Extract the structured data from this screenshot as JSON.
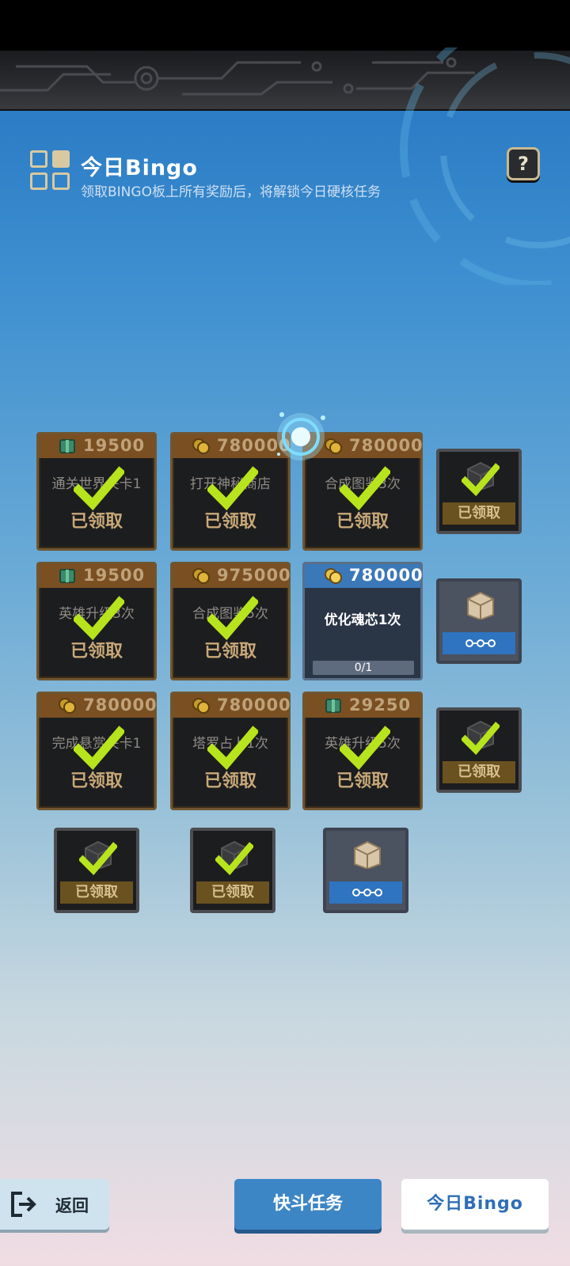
{
  "header": {
    "title": "今日Bingo",
    "subtitle": "领取BINGO板上所有奖励后，将解锁今日硬核任务",
    "help_label": "?"
  },
  "grid": [
    {
      "cost": "19500",
      "currency": "book-icon",
      "task": "通关世界关卡1",
      "status": "已领取",
      "state": "claimed"
    },
    {
      "cost": "780000",
      "currency": "coin-icon",
      "task": "打开神秘商店",
      "status": "已领取",
      "state": "claimed"
    },
    {
      "cost": "780000",
      "currency": "coin-icon",
      "task": "合成图鉴3次",
      "status": "已领取",
      "state": "claimed"
    },
    {
      "cost": "19500",
      "currency": "book-icon",
      "task": "英雄升级3次",
      "status": "已领取",
      "state": "claimed"
    },
    {
      "cost": "975000",
      "currency": "coin-icon",
      "task": "合成图鉴5次",
      "status": "已领取",
      "state": "claimed"
    },
    {
      "cost": "780000",
      "currency": "coin-icon",
      "task": "优化魂芯1次",
      "progress": "0/1",
      "progress_value": 0,
      "state": "active"
    },
    {
      "cost": "780000",
      "currency": "coin-icon",
      "task": "完成悬赏关卡1",
      "status": "已领取",
      "state": "claimed"
    },
    {
      "cost": "780000",
      "currency": "coin-icon",
      "task": "塔罗占卜1次",
      "status": "已领取",
      "state": "claimed"
    },
    {
      "cost": "29250",
      "currency": "book-icon",
      "task": "英雄升级5次",
      "status": "已领取",
      "state": "claimed"
    }
  ],
  "row_rewards": [
    {
      "status": "已领取",
      "state": "claimed"
    },
    {
      "status": "",
      "state": "locked"
    },
    {
      "status": "已领取",
      "state": "claimed"
    }
  ],
  "column_rewards": [
    {
      "status": "已领取",
      "state": "claimed"
    },
    {
      "status": "已领取",
      "state": "claimed"
    },
    {
      "status": "",
      "state": "locked"
    }
  ],
  "footer": {
    "back_label": "返回",
    "tasks_tab": "快斗任务",
    "bingo_tab": "今日Bingo"
  },
  "colors": {
    "claimed_text": "#c9a978",
    "check_green": "#b7e41d",
    "accent_blue": "#3d86c6"
  }
}
